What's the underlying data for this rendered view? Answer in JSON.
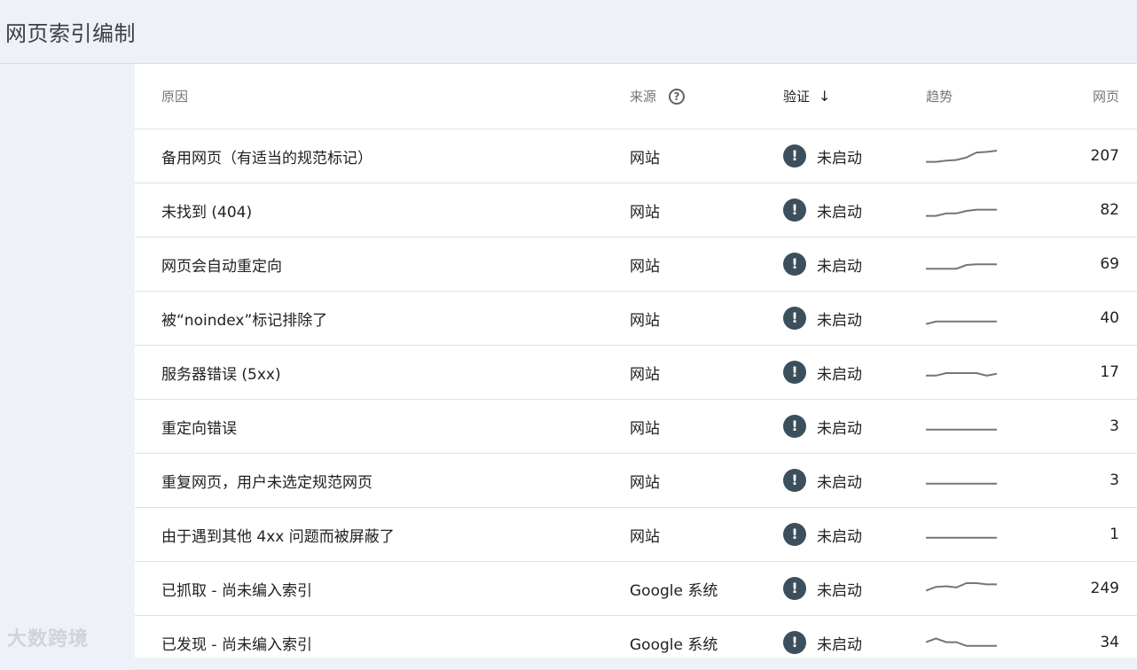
{
  "header": {
    "title": "网页索引编制"
  },
  "table": {
    "columns": {
      "reason": "原因",
      "source": "来源",
      "validation": "验证",
      "trend": "趋势",
      "pages": "网页"
    },
    "help_glyph": "?",
    "sort_glyph": "↓",
    "alert_glyph": "!",
    "rows": [
      {
        "reason": "备用网页（有适当的规范标记）",
        "source": "网站",
        "status": "未启动",
        "pages": "207",
        "trend": [
          0.1,
          0.1,
          0.2,
          0.25,
          0.45,
          0.85,
          0.9,
          1.0
        ]
      },
      {
        "reason": "未找到 (404)",
        "source": "网站",
        "status": "未启动",
        "pages": "82",
        "trend": [
          0.1,
          0.1,
          0.3,
          0.3,
          0.5,
          0.6,
          0.6,
          0.6
        ]
      },
      {
        "reason": "网页会自动重定向",
        "source": "网站",
        "status": "未启动",
        "pages": "69",
        "trend": [
          0.2,
          0.2,
          0.2,
          0.2,
          0.5,
          0.55,
          0.55,
          0.55
        ]
      },
      {
        "reason": "被“noindex”标记排除了",
        "source": "网站",
        "status": "未启动",
        "pages": "40",
        "trend": [
          0.1,
          0.3,
          0.3,
          0.3,
          0.3,
          0.3,
          0.3,
          0.3
        ]
      },
      {
        "reason": "服务器错误 (5xx)",
        "source": "网站",
        "status": "未启动",
        "pages": "17",
        "trend": [
          0.3,
          0.3,
          0.5,
          0.5,
          0.5,
          0.5,
          0.3,
          0.45
        ]
      },
      {
        "reason": "重定向错误",
        "source": "网站",
        "status": "未启动",
        "pages": "3",
        "trend": [
          0.3,
          0.3,
          0.3,
          0.3,
          0.3,
          0.3,
          0.3,
          0.3
        ]
      },
      {
        "reason": "重复网页，用户未选定规范网页",
        "source": "网站",
        "status": "未启动",
        "pages": "3",
        "trend": [
          0.3,
          0.3,
          0.3,
          0.3,
          0.3,
          0.3,
          0.3,
          0.3
        ]
      },
      {
        "reason": "由于遇到其他 4xx 问题而被屏蔽了",
        "source": "网站",
        "status": "未启动",
        "pages": "1",
        "trend": [
          0.3,
          0.3,
          0.3,
          0.3,
          0.3,
          0.3,
          0.3,
          0.3
        ]
      },
      {
        "reason": "已抓取 - 尚未编入索引",
        "source": "Google 系统",
        "status": "未启动",
        "pages": "249",
        "trend": [
          0.4,
          0.7,
          0.75,
          0.65,
          1.0,
          1.0,
          0.9,
          0.9
        ]
      },
      {
        "reason": "已发现 - 尚未编入索引",
        "source": "Google 系统",
        "status": "未启动",
        "pages": "34",
        "trend": [
          0.6,
          0.9,
          0.6,
          0.6,
          0.3,
          0.3,
          0.3,
          0.3
        ]
      }
    ]
  },
  "watermark": "大数跨境",
  "colors": {
    "sparkline": "#757575",
    "alert": "#3c4f5c"
  }
}
